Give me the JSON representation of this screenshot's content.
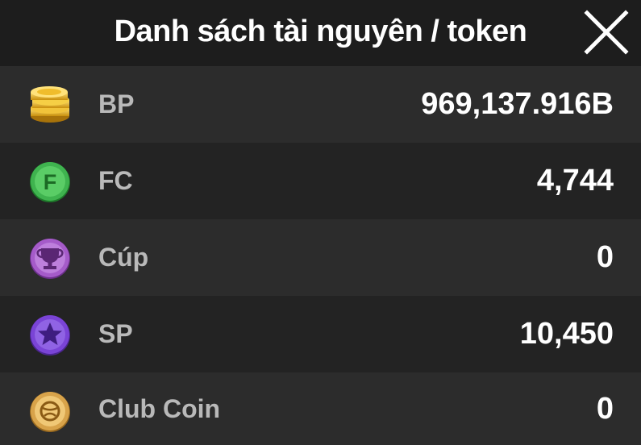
{
  "header": {
    "title": "Danh sách tài nguyên / token"
  },
  "resources": [
    {
      "icon": "gold-coins-icon",
      "label": "BP",
      "value": "969,137.916B"
    },
    {
      "icon": "fc-coin-icon",
      "label": "FC",
      "value": "4,744"
    },
    {
      "icon": "trophy-icon",
      "label": "Cúp",
      "value": "0"
    },
    {
      "icon": "star-coin-icon",
      "label": "SP",
      "value": "10,450"
    },
    {
      "icon": "club-coin-icon",
      "label": "Club Coin",
      "value": "0"
    }
  ],
  "colors": {
    "background": "#1e1e1e",
    "row_light": "#2c2c2c",
    "row_dark": "#232323",
    "label": "#b9b9b9",
    "value": "#ffffff",
    "fc_green": "#3fb34f",
    "trophy_purple": "#a55bc9",
    "star_purple": "#7a44d6",
    "club_gold": "#d8a34a"
  }
}
